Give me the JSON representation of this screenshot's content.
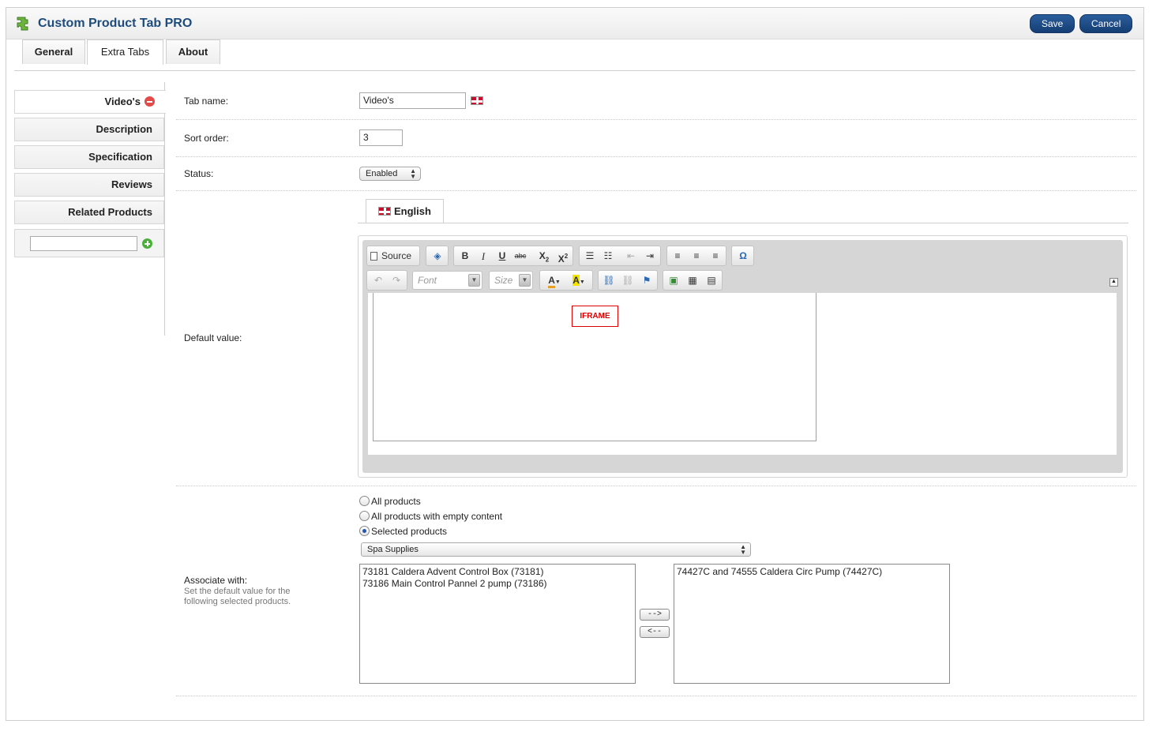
{
  "header": {
    "title": "Custom Product Tab PRO",
    "save_label": "Save",
    "cancel_label": "Cancel"
  },
  "tabs": [
    "General",
    "Extra Tabs",
    "About"
  ],
  "sidebar": {
    "items": [
      "Video's",
      "Description",
      "Specification",
      "Reviews",
      "Related Products"
    ],
    "new_tab_value": ""
  },
  "form": {
    "tab_name_label": "Tab name:",
    "tab_name_value": "Video's",
    "sort_order_label": "Sort order:",
    "sort_order_value": "3",
    "status_label": "Status:",
    "status_value": "Enabled",
    "default_value_label": "Default value:",
    "language_tab": "English",
    "associate_label": "Associate with:",
    "associate_hint": "Set the default value for the following selected products."
  },
  "editor": {
    "source_label": "Source",
    "font_placeholder": "Font",
    "size_placeholder": "Size",
    "iframe_label": "IFRAME"
  },
  "association": {
    "options": [
      "All products",
      "All products with empty content",
      "Selected products"
    ],
    "selected_option": "Selected products",
    "category": "Spa Supplies",
    "available": [
      "73181 Caldera Advent Control Box (73181)",
      "73186 Main Control Pannel 2 pump (73186)"
    ],
    "selected": [
      "74427C and 74555 Caldera Circ Pump (74427C)"
    ],
    "add_label": "-->",
    "remove_label": "<--"
  },
  "colors": {
    "accent": "#1d4b7c",
    "button": "#1a4a86",
    "remove": "#e34a4a",
    "add": "#4caf3c",
    "iframe": "#dd0000"
  }
}
